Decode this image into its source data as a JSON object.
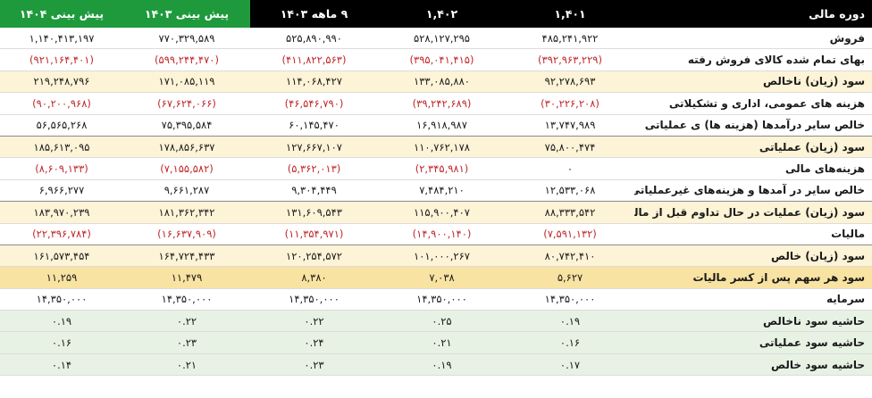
{
  "columns": [
    "دوره مالی",
    "۱,۴۰۱",
    "۱,۴۰۲",
    "۹ ماهه ۱۴۰۳",
    "پیش بینی ۱۴۰۳",
    "پیش بینی ۱۴۰۴"
  ],
  "colors": {
    "header_bg": "#000000",
    "forecast_header_bg": "#1e9a3c",
    "negative_text": "#c0262a",
    "highlight_row": "#fdf3d6",
    "eps_row": "#f8e3a2",
    "margin_rows": "#e7f2e4"
  },
  "rows": [
    {
      "label": "فروش",
      "values": [
        "۴۸۵,۲۴۱,۹۲۲",
        "۵۲۸,۱۲۷,۲۹۵",
        "۵۲۵,۸۹۰,۹۹۰",
        "۷۷۰,۳۲۹,۵۸۹",
        "۱,۱۴۰,۴۱۳,۱۹۷"
      ],
      "style": "white",
      "negative": false
    },
    {
      "label": "بهای تمام شده کالای فروش رفته",
      "values": [
        "(۳۹۲,۹۶۳,۲۲۹)",
        "(۳۹۵,۰۴۱,۴۱۵)",
        "(۴۱۱,۸۲۲,۵۶۳)",
        "(۵۹۹,۲۴۴,۴۷۰)",
        "(۹۲۱,۱۶۴,۴۰۱)"
      ],
      "style": "white",
      "negative": true
    },
    {
      "label": "سود (زیان) ناخالص",
      "values": [
        "۹۲,۲۷۸,۶۹۳",
        "۱۳۳,۰۸۵,۸۸۰",
        "۱۱۴,۰۶۸,۴۲۷",
        "۱۷۱,۰۸۵,۱۱۹",
        "۲۱۹,۲۴۸,۷۹۶"
      ],
      "style": "hl",
      "negative": false
    },
    {
      "label": "هزینه های عمومی، اداری و تشکیلاتی",
      "values": [
        "(۳۰,۲۲۶,۲۰۸)",
        "(۳۹,۲۴۲,۶۸۹)",
        "(۴۶,۵۴۶,۷۹۰)",
        "(۶۷,۶۲۴,۰۶۶)",
        "(۹۰,۲۰۰,۹۶۸)"
      ],
      "style": "white",
      "negative": true
    },
    {
      "label": "خالص سایر درآمدها (هزینه ها) ی عملیاتی",
      "values": [
        "۱۳,۷۴۷,۹۸۹",
        "۱۶,۹۱۸,۹۸۷",
        "۶۰,۱۴۵,۴۷۰",
        "۷۵,۳۹۵,۵۸۴",
        "۵۶,۵۶۵,۲۶۸"
      ],
      "style": "white",
      "negative": false,
      "sep": true
    },
    {
      "label": "سود (زیان) عملیاتی",
      "values": [
        "۷۵,۸۰۰,۴۷۴",
        "۱۱۰,۷۶۲,۱۷۸",
        "۱۲۷,۶۶۷,۱۰۷",
        "۱۷۸,۸۵۶,۶۳۷",
        "۱۸۵,۶۱۳,۰۹۵"
      ],
      "style": "hl",
      "negative": false
    },
    {
      "label": "هزینه‌های مالی",
      "values": [
        "۰",
        "(۲,۳۴۵,۹۸۱)",
        "(۵,۳۶۲,۰۱۳)",
        "(۷,۱۵۵,۵۸۲)",
        "(۸,۶۰۹,۱۳۳)"
      ],
      "style": "white",
      "negative": true
    },
    {
      "label": "خالص سایر در آمدها و هزینه‌های غیرعملیاتی",
      "values": [
        "۱۲,۵۳۳,۰۶۸",
        "۷,۴۸۴,۲۱۰",
        "۹,۳۰۴,۴۴۹",
        "۹,۶۶۱,۲۸۷",
        "۶,۹۶۶,۲۷۷"
      ],
      "style": "white",
      "negative": false,
      "sep": true
    },
    {
      "label": "سود (زیان) عملیات در حال تداوم قبل از مالیات",
      "values": [
        "۸۸,۳۳۳,۵۴۲",
        "۱۱۵,۹۰۰,۴۰۷",
        "۱۳۱,۶۰۹,۵۴۳",
        "۱۸۱,۳۶۲,۳۴۲",
        "۱۸۳,۹۷۰,۲۳۹"
      ],
      "style": "hl",
      "negative": false
    },
    {
      "label": "مالیات",
      "values": [
        "(۷,۵۹۱,۱۳۲)",
        "(۱۴,۹۰۰,۱۴۰)",
        "(۱۱,۳۵۴,۹۷۱)",
        "(۱۶,۶۳۷,۹۰۹)",
        "(۲۲,۳۹۶,۷۸۴)"
      ],
      "style": "white",
      "negative": true,
      "sep": true
    },
    {
      "label": "سود (زیان) خالص",
      "values": [
        "۸۰,۷۴۲,۴۱۰",
        "۱۰۱,۰۰۰,۲۶۷",
        "۱۲۰,۲۵۴,۵۷۲",
        "۱۶۴,۷۲۴,۴۳۳",
        "۱۶۱,۵۷۳,۴۵۴"
      ],
      "style": "hl",
      "negative": false
    },
    {
      "label": "سود هر سهم پس از کسر مالیات",
      "values": [
        "۵,۶۲۷",
        "۷,۰۳۸",
        "۸,۳۸۰",
        "۱۱,۴۷۹",
        "۱۱,۲۵۹"
      ],
      "style": "hl2",
      "negative": false
    },
    {
      "label": "سرمایه",
      "values": [
        "۱۴,۳۵۰,۰۰۰",
        "۱۴,۳۵۰,۰۰۰",
        "۱۴,۳۵۰,۰۰۰",
        "۱۴,۳۵۰,۰۰۰",
        "۱۴,۳۵۰,۰۰۰"
      ],
      "style": "white",
      "negative": false
    },
    {
      "label": "حاشیه سود ناخالص",
      "values": [
        "۰.۱۹",
        "۰.۲۵",
        "۰.۲۲",
        "۰.۲۲",
        "۰.۱۹"
      ],
      "style": "gr",
      "negative": false
    },
    {
      "label": "حاشیه سود عملیاتی",
      "values": [
        "۰.۱۶",
        "۰.۲۱",
        "۰.۲۴",
        "۰.۲۳",
        "۰.۱۶"
      ],
      "style": "gr",
      "negative": false
    },
    {
      "label": "حاشیه سود خالص",
      "values": [
        "۰.۱۷",
        "۰.۱۹",
        "۰.۲۳",
        "۰.۲۱",
        "۰.۱۴"
      ],
      "style": "gr",
      "negative": false
    }
  ]
}
